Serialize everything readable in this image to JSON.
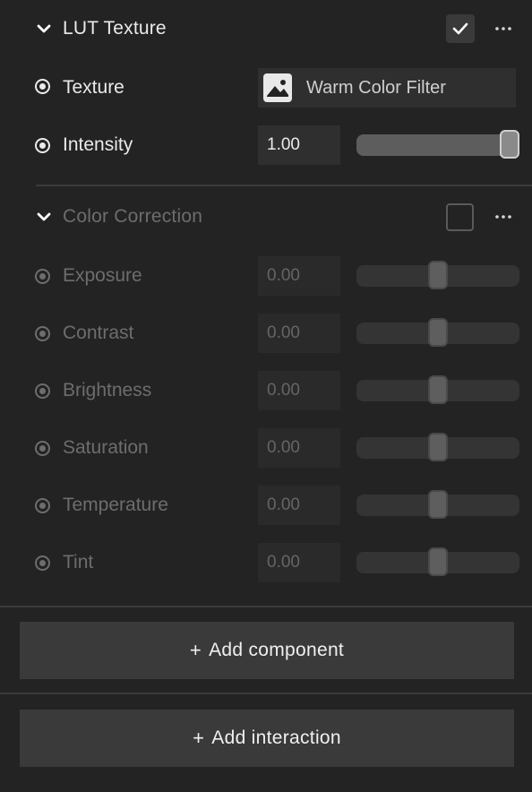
{
  "lut_section": {
    "title": "LUT Texture",
    "enabled": true,
    "more_icon": "ellipsis-icon",
    "texture": {
      "label": "Texture",
      "value": "Warm Color Filter",
      "thumb_icon": "image-icon"
    },
    "intensity": {
      "label": "Intensity",
      "value": "1.00",
      "slider_fraction": 1.0
    }
  },
  "color_section": {
    "title": "Color Correction",
    "enabled": false,
    "more_icon": "ellipsis-icon",
    "rows": [
      {
        "label": "Exposure",
        "value": "0.00",
        "slider_fraction": 0.5
      },
      {
        "label": "Contrast",
        "value": "0.00",
        "slider_fraction": 0.5
      },
      {
        "label": "Brightness",
        "value": "0.00",
        "slider_fraction": 0.5
      },
      {
        "label": "Saturation",
        "value": "0.00",
        "slider_fraction": 0.5
      },
      {
        "label": "Temperature",
        "value": "0.00",
        "slider_fraction": 0.5
      },
      {
        "label": "Tint",
        "value": "0.00",
        "slider_fraction": 0.5
      }
    ]
  },
  "buttons": {
    "add_component": "Add component",
    "add_interaction": "Add interaction",
    "plus_glyph": "+"
  }
}
